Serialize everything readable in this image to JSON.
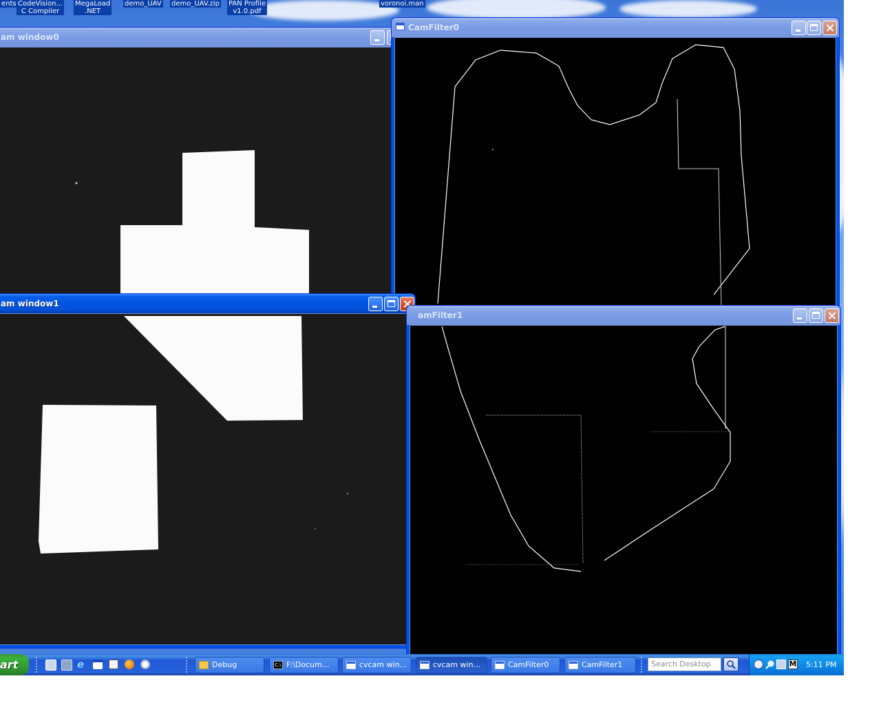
{
  "desktop_icons": [
    {
      "label": "ents"
    },
    {
      "label": "CodeVision...\nC Compiler"
    },
    {
      "label": "MegaLoad\n.NET"
    },
    {
      "label": "demo_UAV"
    },
    {
      "label": "demo_UAV.zip"
    },
    {
      "label": "PAN Profile\nv1.0.pdf"
    },
    {
      "label": "voronoi.man"
    }
  ],
  "windows": {
    "cam0": {
      "title": "am window0"
    },
    "camfilter0": {
      "title": "CamFilter0"
    },
    "cam1": {
      "title": "am window1"
    },
    "camfilter1": {
      "title": "amFilter1"
    }
  },
  "taskbar": {
    "start_label": "art",
    "quick_launch": [
      "desktop-icon",
      "disk-icon",
      "internet-explorer-icon",
      "window-icon",
      "calculator-icon",
      "firefox-icon",
      "media-player-icon"
    ],
    "buttons": [
      {
        "label": "Debug",
        "icon": "folder-icon"
      },
      {
        "label": "F:\\Docum...",
        "icon": "cmd-icon"
      },
      {
        "label": "cvcam win...",
        "icon": "window-icon"
      },
      {
        "label": "cvcam win...",
        "icon": "window-icon",
        "active": true
      },
      {
        "label": "CamFilter0",
        "icon": "window-icon"
      },
      {
        "label": "CamFilter1",
        "icon": "window-icon"
      }
    ],
    "search_placeholder": "Search Desktop",
    "clock": "5:11 PM"
  },
  "colors": {
    "xp_blue": "#0054e3",
    "start_green": "#3ab13a",
    "tray_blue": "#0c87e6"
  }
}
